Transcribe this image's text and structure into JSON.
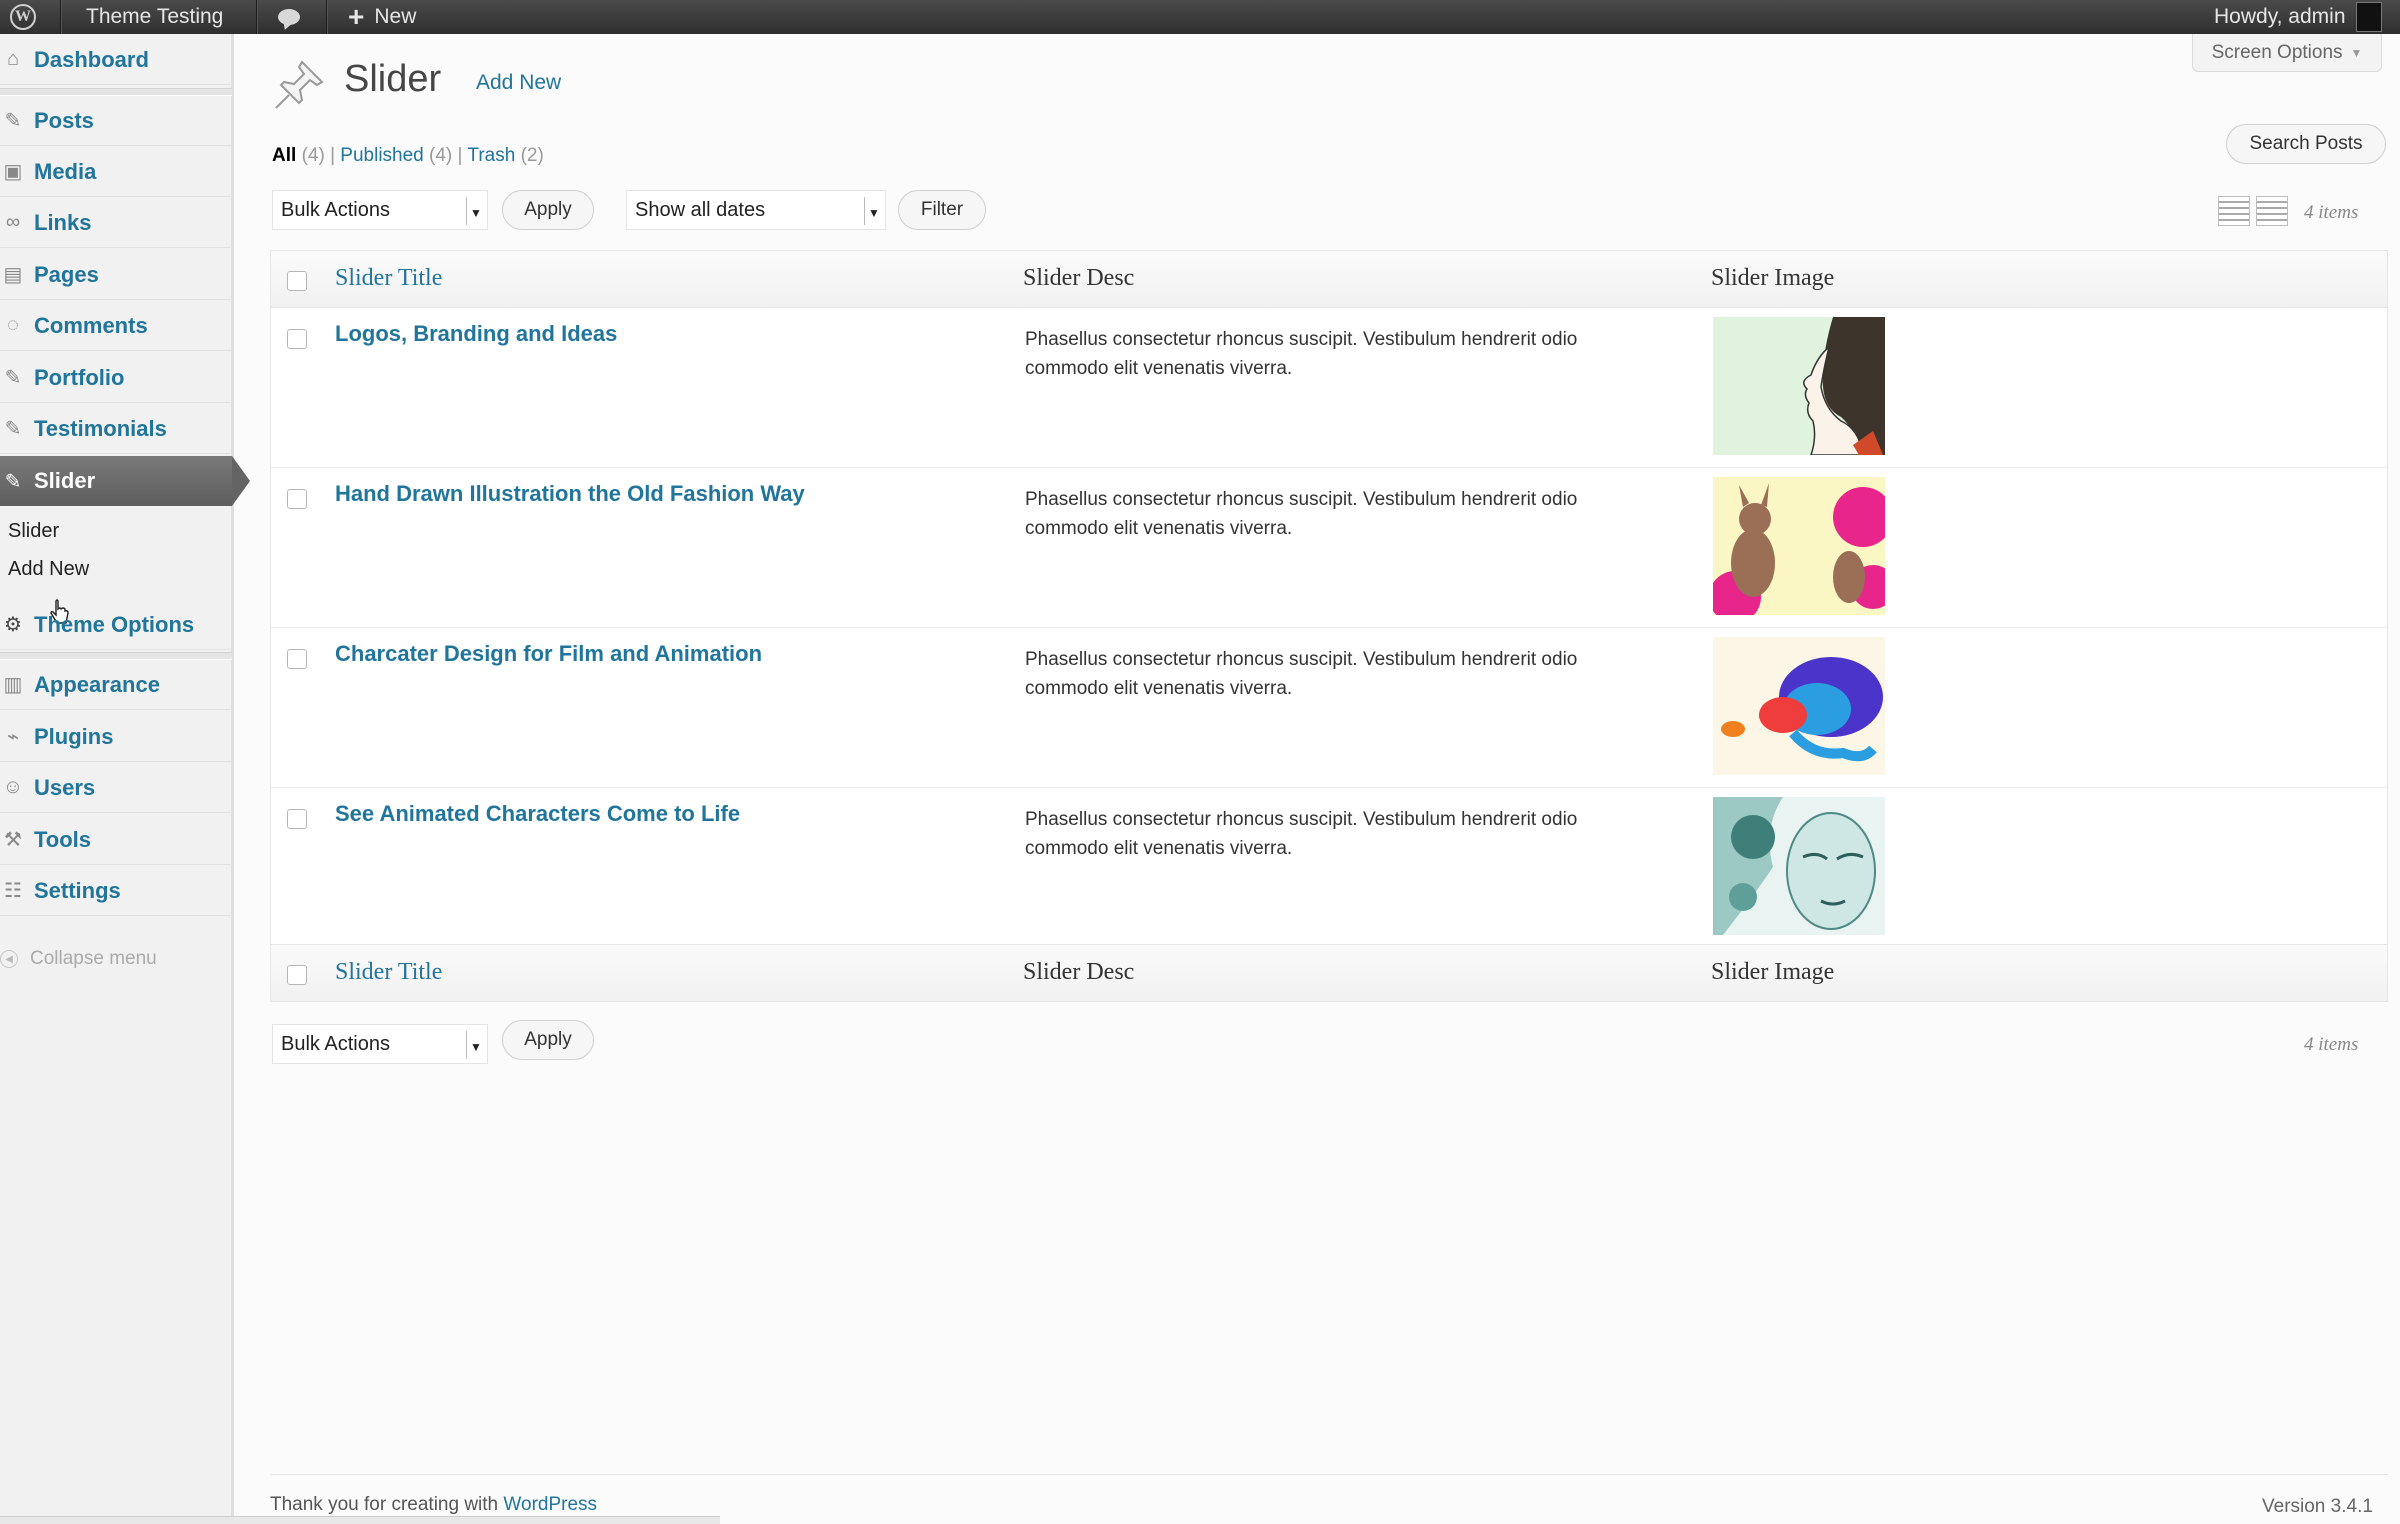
{
  "adminbar": {
    "site_name": "Theme Testing",
    "new_label": "New",
    "howdy": "Howdy, admin"
  },
  "sidebar": {
    "items": [
      {
        "label": "Dashboard",
        "icon": "home-icon"
      },
      {
        "label": "Posts",
        "icon": "pin-icon"
      },
      {
        "label": "Media",
        "icon": "media-icon"
      },
      {
        "label": "Links",
        "icon": "link-icon"
      },
      {
        "label": "Pages",
        "icon": "page-icon"
      },
      {
        "label": "Comments",
        "icon": "comment-icon"
      },
      {
        "label": "Portfolio",
        "icon": "pin-icon"
      },
      {
        "label": "Testimonials",
        "icon": "pin-icon"
      },
      {
        "label": "Slider",
        "icon": "pin-icon"
      },
      {
        "label": "Theme Options",
        "icon": "gear-icon"
      },
      {
        "label": "Appearance",
        "icon": "appearance-icon"
      },
      {
        "label": "Plugins",
        "icon": "plugin-icon"
      },
      {
        "label": "Users",
        "icon": "users-icon"
      },
      {
        "label": "Tools",
        "icon": "tools-icon"
      },
      {
        "label": "Settings",
        "icon": "settings-icon"
      }
    ],
    "submenu": [
      "Slider",
      "Add New"
    ],
    "collapse": "Collapse menu"
  },
  "screen_options": "Screen Options",
  "page": {
    "title": "Slider",
    "add_new": "Add New"
  },
  "filters": {
    "all": "All",
    "all_count": "(4)",
    "published": "Published",
    "published_count": "(4)",
    "trash": "Trash",
    "trash_count": "(2)",
    "sep": "|"
  },
  "search_button": "Search Posts",
  "toolbar": {
    "bulk_actions": "Bulk Actions",
    "apply": "Apply",
    "show_all_dates": "Show all dates",
    "filter": "Filter",
    "items_count": "4 items"
  },
  "table": {
    "columns": [
      "Slider Title",
      "Slider Desc",
      "Slider Image"
    ],
    "rows": [
      {
        "title": "Logos, Branding and Ideas",
        "desc": "Phasellus consectetur rhoncus suscipit. Vestibulum hendrerit odio commodo elit venenatis viverra."
      },
      {
        "title": "Hand Drawn Illustration the Old Fashion Way",
        "desc": "Phasellus consectetur rhoncus suscipit. Vestibulum hendrerit odio commodo elit venenatis viverra."
      },
      {
        "title": "Charcater Design for Film and Animation",
        "desc": "Phasellus consectetur rhoncus suscipit. Vestibulum hendrerit odio commodo elit venenatis viverra."
      },
      {
        "title": "See Animated Characters Come to Life",
        "desc": "Phasellus consectetur rhoncus suscipit. Vestibulum hendrerit odio commodo elit venenatis viverra."
      }
    ]
  },
  "footer": {
    "thanks": "Thank you for creating with",
    "wordpress": "WordPress",
    "version": "Version 3.4.1"
  }
}
